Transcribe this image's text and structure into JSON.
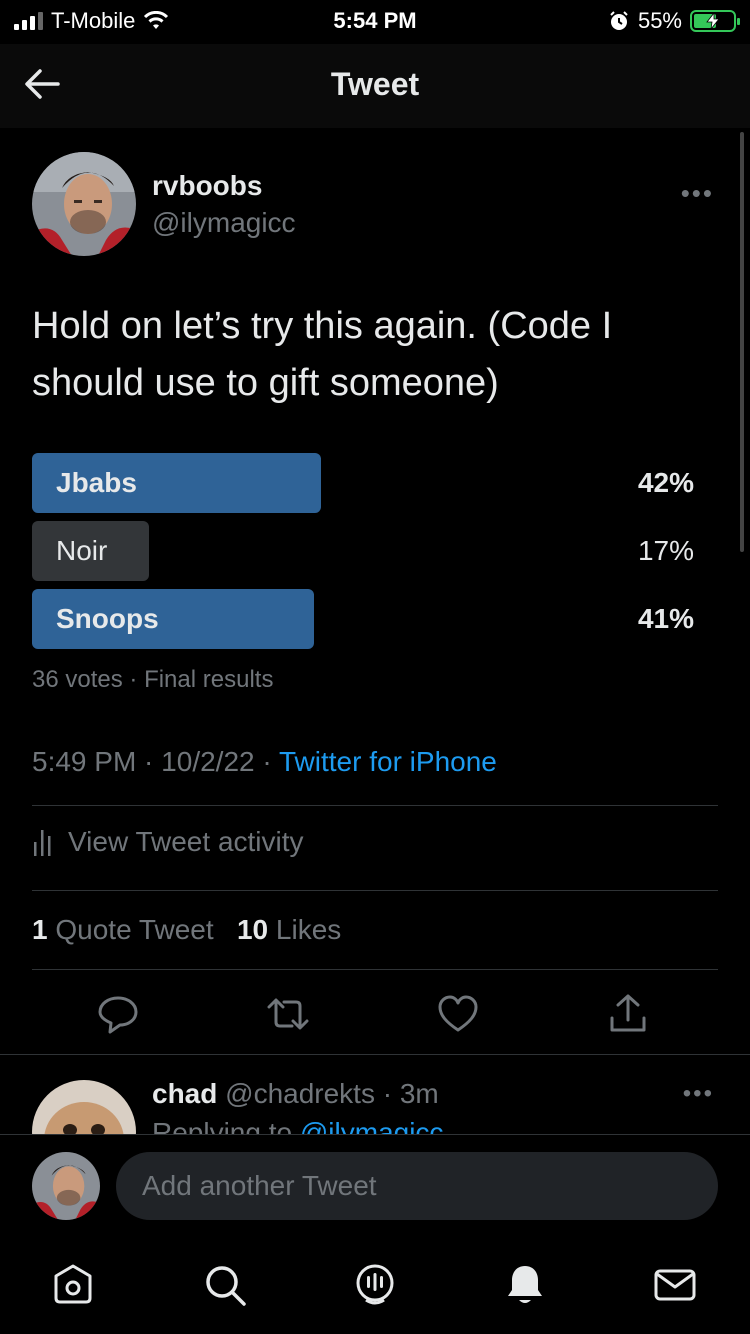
{
  "status_bar": {
    "carrier": "T-Mobile",
    "time": "5:54 PM",
    "battery": "55%"
  },
  "header": {
    "title": "Tweet"
  },
  "tweet": {
    "author_name": "rvboobs",
    "author_handle": "@ilymagicc",
    "text": "Hold on let’s try this again. (Code I should use to gift someone)",
    "poll": {
      "options": [
        {
          "label": "Jbabs",
          "percent": "42%",
          "value": 42,
          "winner": true
        },
        {
          "label": "Noir",
          "percent": "17%",
          "value": 17,
          "winner": false
        },
        {
          "label": "Snoops",
          "percent": "41%",
          "value": 41,
          "winner": true
        }
      ],
      "votes": "36 votes",
      "separator": " · ",
      "status": "Final results"
    },
    "time": "5:49 PM",
    "date": "10/2/22",
    "meta_separator": " · ",
    "source": "Twitter for iPhone",
    "activity_label": "View Tweet activity",
    "quote_count": "1",
    "quote_label": "Quote Tweet",
    "like_count": "10",
    "like_label": "Likes"
  },
  "reply": {
    "name": "chad",
    "handle": "@chadrekts",
    "separator": " · ",
    "time": "3m",
    "replying_prefix": "Replying to ",
    "replying_to": "@ilymagicc"
  },
  "compose": {
    "placeholder": "Add another Tweet"
  },
  "colors": {
    "accent": "#1d9bf0",
    "poll_winner": "#2f6397",
    "poll_other": "#333639",
    "muted": "#71767b"
  }
}
